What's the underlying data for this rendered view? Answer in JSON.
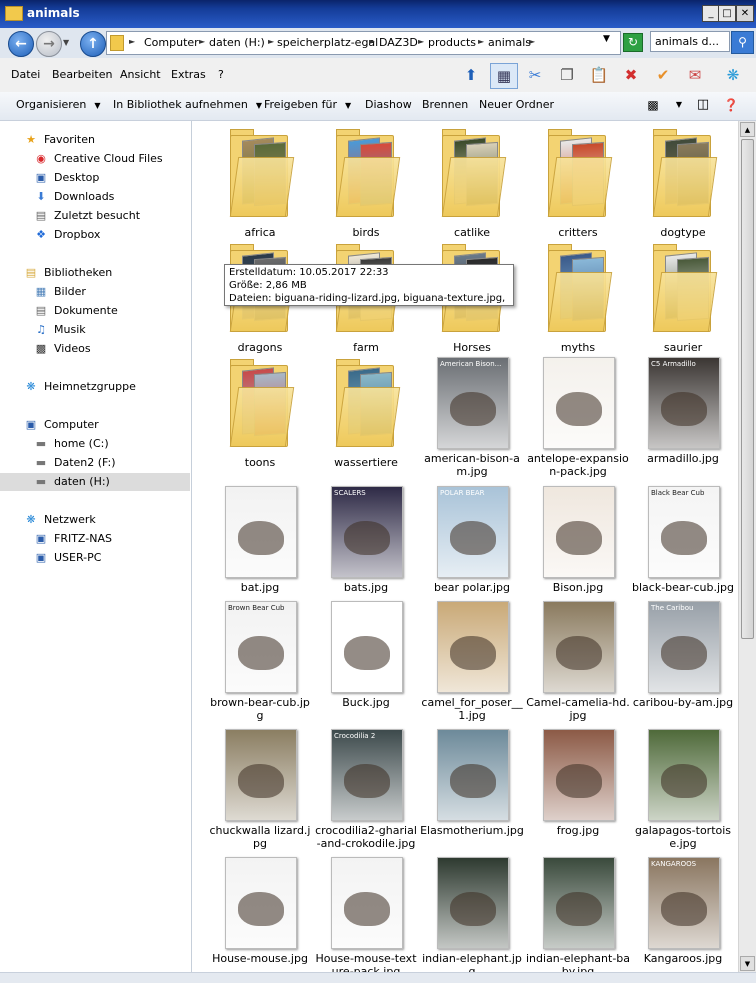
{
  "window": {
    "title": "animals",
    "buttons": [
      "_",
      "□",
      "✕"
    ]
  },
  "address": {
    "crumbs": [
      "Computer",
      "daten (H:)",
      "speicherplatz-egal",
      "DAZ3D",
      "products",
      "animals"
    ],
    "search_value": "animals d..."
  },
  "menu": [
    "Datei",
    "Bearbeiten",
    "Ansicht",
    "Extras",
    "?"
  ],
  "commands": [
    "Organisieren",
    "In Bibliothek aufnehmen",
    "Freigeben für",
    "Diashow",
    "Brennen",
    "Neuer Ordner"
  ],
  "nav": {
    "favorites": {
      "header": "Favoriten",
      "items": [
        "Creative Cloud Files",
        "Desktop",
        "Downloads",
        "Zuletzt besucht",
        "Dropbox"
      ]
    },
    "libraries": {
      "header": "Bibliotheken",
      "items": [
        "Bilder",
        "Dokumente",
        "Musik",
        "Videos"
      ]
    },
    "homegroup": "Heimnetzgruppe",
    "computer": {
      "header": "Computer",
      "items": [
        "home (C:)",
        "Daten2 (F:)",
        "daten (H:)"
      ]
    },
    "network": {
      "header": "Netzwerk",
      "items": [
        "FRITZ-NAS",
        "USER-PC"
      ]
    }
  },
  "items": [
    {
      "label": "africa",
      "kind": "folder"
    },
    {
      "label": "birds",
      "kind": "folder"
    },
    {
      "label": "catlike",
      "kind": "folder"
    },
    {
      "label": "critters",
      "kind": "folder"
    },
    {
      "label": "dogtype",
      "kind": "folder"
    },
    {
      "label": "dragons",
      "kind": "folder"
    },
    {
      "label": "farm",
      "kind": "folder"
    },
    {
      "label": "Horses",
      "kind": "folder"
    },
    {
      "label": "myths",
      "kind": "folder"
    },
    {
      "label": "saurier",
      "kind": "folder"
    },
    {
      "label": "toons",
      "kind": "folder"
    },
    {
      "label": "wassertiere",
      "kind": "folder"
    },
    {
      "label": "american-bison-am.jpg",
      "kind": "image",
      "title": "American Bison...",
      "color": "#6b6f74"
    },
    {
      "label": "antelope-expansion-pack.jpg",
      "kind": "image",
      "title": "",
      "color": "#f4f1ec"
    },
    {
      "label": "armadillo.jpg",
      "kind": "image",
      "title": "C5 Armadillo",
      "color": "#3b3633"
    },
    {
      "label": "bat.jpg",
      "kind": "image",
      "title": "",
      "color": "#f2f2f2"
    },
    {
      "label": "bats.jpg",
      "kind": "image",
      "title": "SCALERS",
      "color": "#2e2a46"
    },
    {
      "label": "bear polar.jpg",
      "kind": "image",
      "title": "POLAR BEAR",
      "color": "#a9c3d8"
    },
    {
      "label": "Bison.jpg",
      "kind": "image",
      "title": "",
      "color": "#efe7de"
    },
    {
      "label": "black-bear-cub.jpg",
      "kind": "image",
      "title": "Black Bear Cub",
      "color": "#f4f4f4"
    },
    {
      "label": "brown-bear-cub.jpg",
      "kind": "image",
      "title": "Brown Bear Cub",
      "color": "#f2f2f2"
    },
    {
      "label": "Buck.jpg",
      "kind": "image",
      "title": "",
      "color": "#ffffff"
    },
    {
      "label": "camel_for_poser__1.jpg",
      "kind": "image",
      "title": "",
      "color": "#c9a977"
    },
    {
      "label": "Camel-camelia-hd.jpg",
      "kind": "image",
      "title": "",
      "color": "#8a7a5e"
    },
    {
      "label": "caribou-by-am.jpg",
      "kind": "image",
      "title": "The Caribou",
      "color": "#98a0a8"
    },
    {
      "label": "chuckwalla lizard.jpg",
      "kind": "image",
      "title": "",
      "color": "#8b7e62"
    },
    {
      "label": "crocodilia2-gharial-and-crokodile.jpg",
      "kind": "image",
      "title": "Crocodilia 2",
      "color": "#3d4a4c"
    },
    {
      "label": "Elasmotherium.jpg",
      "kind": "image",
      "title": "",
      "color": "#6d8a9a"
    },
    {
      "label": "frog.jpg",
      "kind": "image",
      "title": "",
      "color": "#8c5a46"
    },
    {
      "label": "galapagos-tortoise.jpg",
      "kind": "image",
      "title": "",
      "color": "#4f6a3a"
    },
    {
      "label": "House-mouse.jpg",
      "kind": "image",
      "title": "",
      "color": "#f3f3f3"
    },
    {
      "label": "House-mouse-texture-pack.jpg",
      "kind": "image",
      "title": "",
      "color": "#f3f3f3"
    },
    {
      "label": "indian-elephant.jpg",
      "kind": "image",
      "title": "",
      "color": "#2e3a30"
    },
    {
      "label": "indian-elephant-baby.jpg",
      "kind": "image",
      "title": "",
      "color": "#3a4a3c"
    },
    {
      "label": "Kangaroos.jpg",
      "kind": "image",
      "title": "KANGAROOS",
      "color": "#8a7660"
    }
  ],
  "tooltip": {
    "line1": "Erstelldatum: 10.05.2017 22:33",
    "line2": "Größe: 2,86 MB",
    "line3": "Dateien: biguana-riding-lizard.jpg, biguana-texture.jpg, ..."
  }
}
